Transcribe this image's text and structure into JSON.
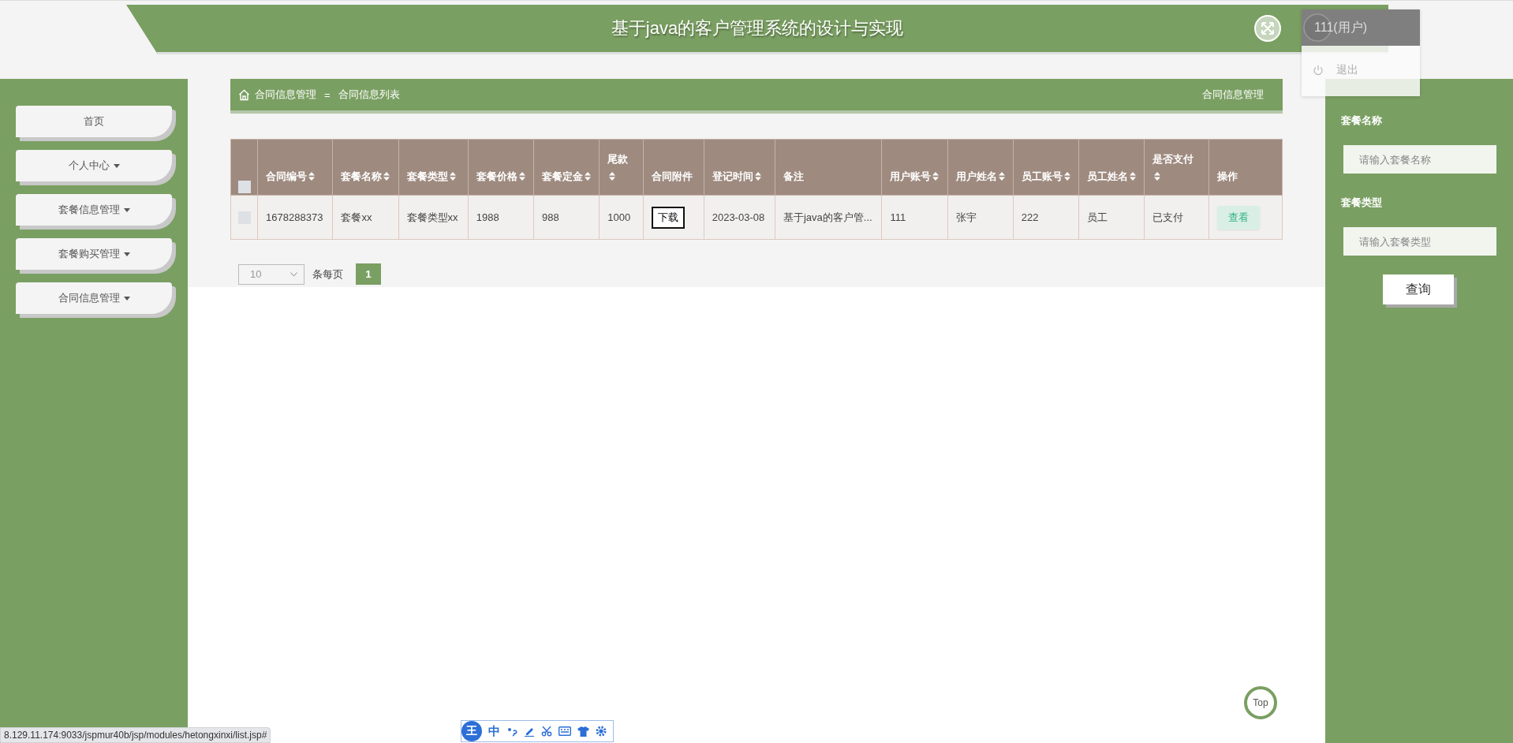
{
  "header": {
    "title": "基于java的客户管理系统的设计与实现"
  },
  "user_menu": {
    "user": "111(用户)",
    "items": [
      {
        "label": "退出"
      }
    ]
  },
  "sidebar": {
    "items": [
      {
        "label": "首页",
        "has_submenu": false
      },
      {
        "label": "个人中心",
        "has_submenu": true
      },
      {
        "label": "套餐信息管理",
        "has_submenu": true
      },
      {
        "label": "套餐购买管理",
        "has_submenu": true
      },
      {
        "label": "合同信息管理",
        "has_submenu": true
      }
    ]
  },
  "breadcrumb": {
    "items": [
      "合同信息管理",
      "合同信息列表"
    ],
    "separator": "=",
    "page_title": "合同信息管理"
  },
  "table": {
    "select_all": {
      "checked": false
    },
    "columns": [
      {
        "label": "合同编号",
        "sortable": true,
        "kind": "text"
      },
      {
        "label": "套餐名称",
        "sortable": true,
        "kind": "text"
      },
      {
        "label": "套餐类型",
        "sortable": true,
        "kind": "text"
      },
      {
        "label": "套餐价格",
        "sortable": true,
        "kind": "text"
      },
      {
        "label": "套餐定金",
        "sortable": true,
        "kind": "text"
      },
      {
        "label": "尾款",
        "sortable": true,
        "kind": "text"
      },
      {
        "label": "合同附件",
        "sortable": false,
        "kind": "download"
      },
      {
        "label": "登记时间",
        "sortable": true,
        "kind": "text"
      },
      {
        "label": "备注",
        "sortable": false,
        "kind": "text"
      },
      {
        "label": "用户账号",
        "sortable": true,
        "kind": "text"
      },
      {
        "label": "用户姓名",
        "sortable": true,
        "kind": "text"
      },
      {
        "label": "员工账号",
        "sortable": true,
        "kind": "text"
      },
      {
        "label": "员工姓名",
        "sortable": true,
        "kind": "text"
      },
      {
        "label": "是否支付",
        "sortable": true,
        "kind": "text"
      },
      {
        "label": "操作",
        "sortable": false,
        "kind": "action"
      }
    ],
    "rows": [
      {
        "selected": false,
        "cells": [
          "1678288373",
          "套餐xx",
          "套餐类型xx",
          "1988",
          "988",
          "1000",
          "下载",
          "2023-03-08",
          "基于java的客户管...",
          "111",
          "张宇",
          "222",
          "员工",
          "已支付",
          "查看"
        ]
      }
    ]
  },
  "pagination": {
    "page_size": "10",
    "label": "条每页",
    "pages": [
      {
        "label": "1",
        "selected": true
      }
    ]
  },
  "search": {
    "fields": [
      {
        "label": "套餐名称",
        "placeholder": "请输入套餐名称"
      },
      {
        "label": "套餐类型",
        "placeholder": "请输入套餐类型"
      }
    ],
    "button": "查询"
  },
  "back_to_top": "Top",
  "status_bar": {
    "url": "8.129.11.174:9033/jspmur40b/jsp/modules/hetongxinxi/list.jsp#"
  },
  "ime_toolbar": {
    "logo": "王",
    "mode": "中"
  }
}
